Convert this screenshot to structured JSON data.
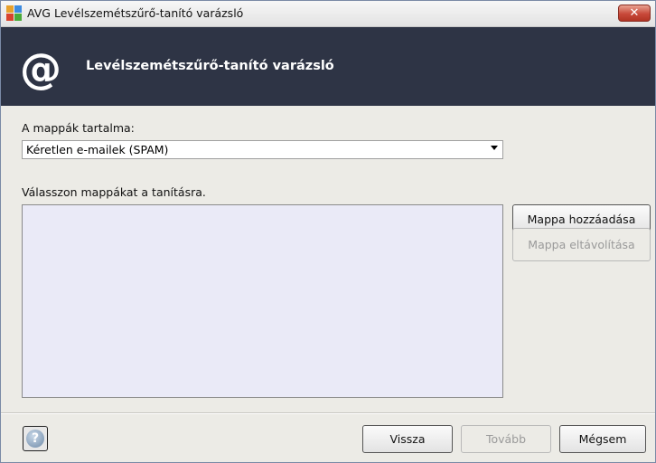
{
  "window": {
    "title": "AVG Levélszemétszűrő-tanító varázsló",
    "close_glyph": "✕"
  },
  "banner": {
    "icon": "at-sign-icon",
    "icon_glyph": "@",
    "title": "Levélszemétszűrő-tanító varázsló"
  },
  "content": {
    "folder_contents_label": "A mappák tartalma:",
    "folder_contents_value": "Kéretlen e-mailek (SPAM)",
    "select_folders_label": "Válasszon mappákat a tanításra.",
    "folders": []
  },
  "buttons": {
    "add_folder": "Mappa hozzáadása",
    "remove_folder": "Mappa eltávolítása",
    "back": "Vissza",
    "next": "Tovább",
    "cancel": "Mégsem"
  },
  "help": {
    "glyph": "?"
  },
  "colors": {
    "banner_bg": "#2e3445",
    "window_bg": "#ecebe6",
    "close_red": "#c8493a",
    "list_bg": "#eaeaf7"
  }
}
